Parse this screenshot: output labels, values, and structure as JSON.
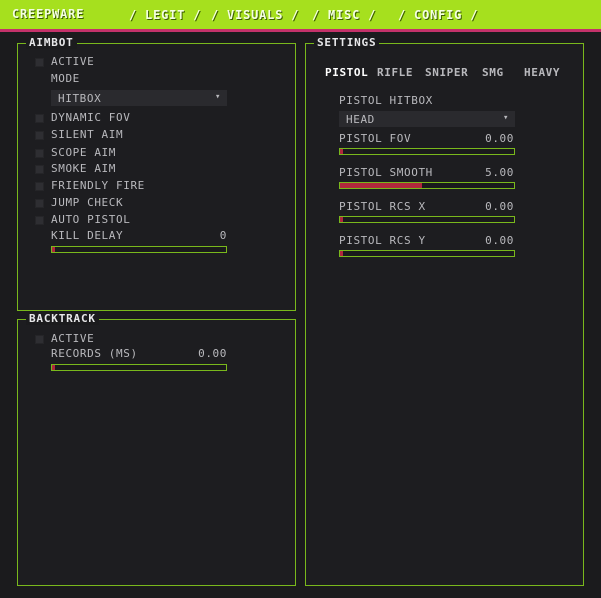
{
  "brand": "CREEPWARE",
  "nav": [
    {
      "label": "/ LEGIT /"
    },
    {
      "label": "/ VISUALS /"
    },
    {
      "label": "/ MISC /"
    },
    {
      "label": "/ CONFIG /"
    }
  ],
  "aimbot": {
    "title": "AIMBOT",
    "active_label": "ACTIVE",
    "mode_label": "MODE",
    "mode_value": "HITBOX",
    "checkboxes": [
      {
        "label": "DYNAMIC FOV"
      },
      {
        "label": "SILENT AIM"
      },
      {
        "label": "SCOPE AIM"
      },
      {
        "label": "SMOKE AIM"
      },
      {
        "label": "FRIENDLY FIRE"
      },
      {
        "label": "JUMP CHECK"
      },
      {
        "label": "AUTO PISTOL"
      }
    ],
    "kill_delay": {
      "label": "KILL DELAY",
      "value": "0",
      "fill": 0.02
    }
  },
  "backtrack": {
    "title": "BACKTRACK",
    "active_label": "ACTIVE",
    "records": {
      "label": "RECORDS (MS)",
      "value": "0.00",
      "fill": 0.02
    }
  },
  "settings": {
    "title": "SETTINGS",
    "tabs": [
      {
        "label": "PISTOL"
      },
      {
        "label": "RIFLE"
      },
      {
        "label": "SNIPER"
      },
      {
        "label": "SMG"
      },
      {
        "label": "HEAVY"
      }
    ],
    "active_tab": "PISTOL",
    "hitbox_label": "PISTOL HITBOX",
    "hitbox_value": "HEAD",
    "sliders": [
      {
        "label": "PISTOL FOV",
        "value": "0.00",
        "fill": 0.02
      },
      {
        "label": "PISTOL SMOOTH",
        "value": "5.00",
        "fill": 0.47
      },
      {
        "label": "PISTOL RCS X",
        "value": "0.00",
        "fill": 0.02
      },
      {
        "label": "PISTOL RCS Y",
        "value": "0.00",
        "fill": 0.02
      }
    ]
  },
  "colors": {
    "accent_green": "#a6e01e",
    "panel_border": "#79b81c",
    "slider_fill": "#b0283c",
    "topbar_underline": "#c4326a"
  }
}
